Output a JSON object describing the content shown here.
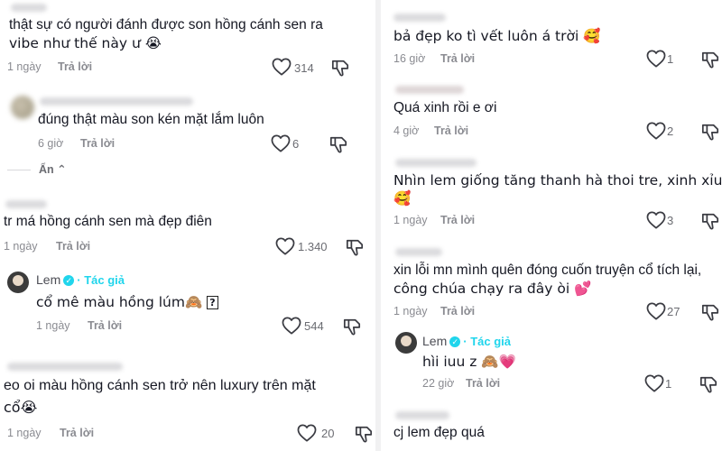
{
  "left": {
    "c1": {
      "text_line1": "thật sự có người đánh được son hồng cánh sen ra",
      "text_line2": "vibe như thế này ư 😭",
      "time": "1 ngày",
      "reply": "Trả lời",
      "likes": "314"
    },
    "c2": {
      "text": "đúng thật màu son kén mặt lắm luôn",
      "time": "6 giờ",
      "reply": "Trả lời",
      "likes": "6",
      "hide": "Ẩn ⌃"
    },
    "c3": {
      "text": "tr má hồng cánh sen mà đẹp điên",
      "time": "1 ngày",
      "reply": "Trả lời",
      "likes": "1.340"
    },
    "c4": {
      "author": "Lem",
      "badge": "Tác giả",
      "text": "cổ mê màu hồng lúm🙈",
      "box": "?",
      "time": "1 ngày",
      "reply": "Trả lời",
      "likes": "544"
    },
    "c5": {
      "text_line1": "eo oi màu hồng cánh sen trở nên luxury trên mặt",
      "text_line2": "cổ😭",
      "time": "1 ngày",
      "reply": "Trả lời",
      "likes": "20"
    }
  },
  "right": {
    "c1": {
      "text": "bả đẹp ko tì vết luôn á trời 🥰",
      "time": "16 giờ",
      "reply": "Trả lời",
      "likes": "1"
    },
    "c2": {
      "text": "Quá xinh rồi e ơi",
      "time": "4 giờ",
      "reply": "Trả lời",
      "likes": "2"
    },
    "c3": {
      "text_line1": "Nhìn lem giống tăng thanh hà thoi tre, xinh xỉu 🥰",
      "text_line2": "🥰",
      "time": "1 ngày",
      "reply": "Trả lời",
      "likes": "3"
    },
    "c4": {
      "text_line1": "xin lỗi mn mình quên đóng cuốn truyện cổ tích lại,",
      "text_line2": "công chúa chạy ra đây òi 💕",
      "time": "1 ngày",
      "reply": "Trả lời",
      "likes": "27"
    },
    "c5": {
      "author": "Lem",
      "badge": "Tác giả",
      "text": "hìi iuu z 🙈💗",
      "time": "22 giờ",
      "reply": "Trả lời",
      "likes": "1"
    },
    "c6": {
      "text": "cj lem đẹp quá"
    }
  }
}
